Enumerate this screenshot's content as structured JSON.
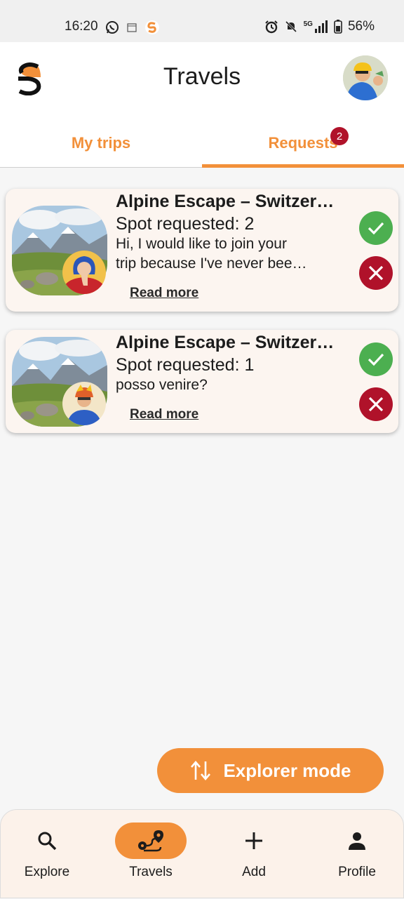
{
  "status_bar": {
    "time": "16:20",
    "battery": "56%",
    "network": "5G"
  },
  "header": {
    "title": "Travels"
  },
  "tabs": [
    {
      "label": "My trips"
    },
    {
      "label": "Requests",
      "badge": "2"
    }
  ],
  "requests": [
    {
      "title": "Alpine Escape – Switzer…",
      "spots": "Spot requested: 2",
      "message_line1": "Hi, I would like to join your",
      "message_line2": "trip because I've never bee…",
      "read_more": "Read more"
    },
    {
      "title": "Alpine Escape – Switzer…",
      "spots": "Spot requested: 1",
      "message_line1": "posso venire?",
      "message_line2": "",
      "read_more": "Read more"
    }
  ],
  "fab": {
    "label": "Explorer mode"
  },
  "bottom_nav": [
    {
      "label": "Explore",
      "icon": "search-icon"
    },
    {
      "label": "Travels",
      "icon": "route-icon",
      "active": true
    },
    {
      "label": "Add",
      "icon": "plus-icon"
    },
    {
      "label": "Profile",
      "icon": "person-icon"
    }
  ],
  "colors": {
    "accent": "#f2903a",
    "accept": "#4caf50",
    "reject": "#b0122a",
    "card_bg": "#fcf5f0"
  }
}
